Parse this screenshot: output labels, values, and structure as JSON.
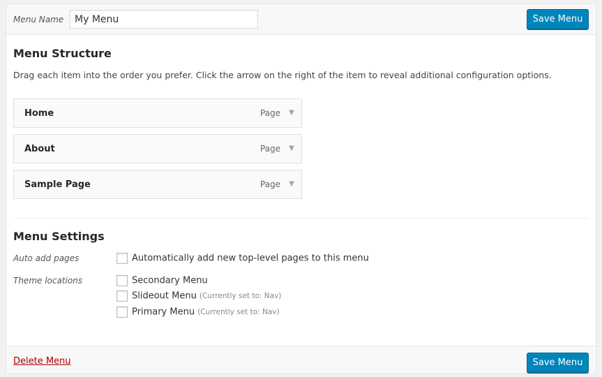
{
  "header": {
    "menu_name_label": "Menu Name",
    "menu_name_value": "My Menu",
    "save_label": "Save Menu"
  },
  "structure": {
    "title": "Menu Structure",
    "description": "Drag each item into the order you prefer. Click the arrow on the right of the item to reveal additional configuration options.",
    "items": [
      {
        "title": "Home",
        "type": "Page"
      },
      {
        "title": "About",
        "type": "Page"
      },
      {
        "title": "Sample Page",
        "type": "Page"
      }
    ]
  },
  "settings": {
    "title": "Menu Settings",
    "auto_add_label": "Auto add pages",
    "auto_add_option": "Automatically add new top-level pages to this menu",
    "theme_locations_label": "Theme locations",
    "locations": [
      {
        "name": "Secondary Menu",
        "note": ""
      },
      {
        "name": "Slideout Menu",
        "note": "(Currently set to: Nav)"
      },
      {
        "name": "Primary Menu",
        "note": "(Currently set to: Nav)"
      }
    ]
  },
  "footer": {
    "delete_label": "Delete Menu",
    "save_label": "Save Menu"
  },
  "colors": {
    "primary_button": "#0085ba",
    "delete_link": "#aa0000"
  },
  "icons": {
    "item_toggle": "triangle-down-icon"
  }
}
